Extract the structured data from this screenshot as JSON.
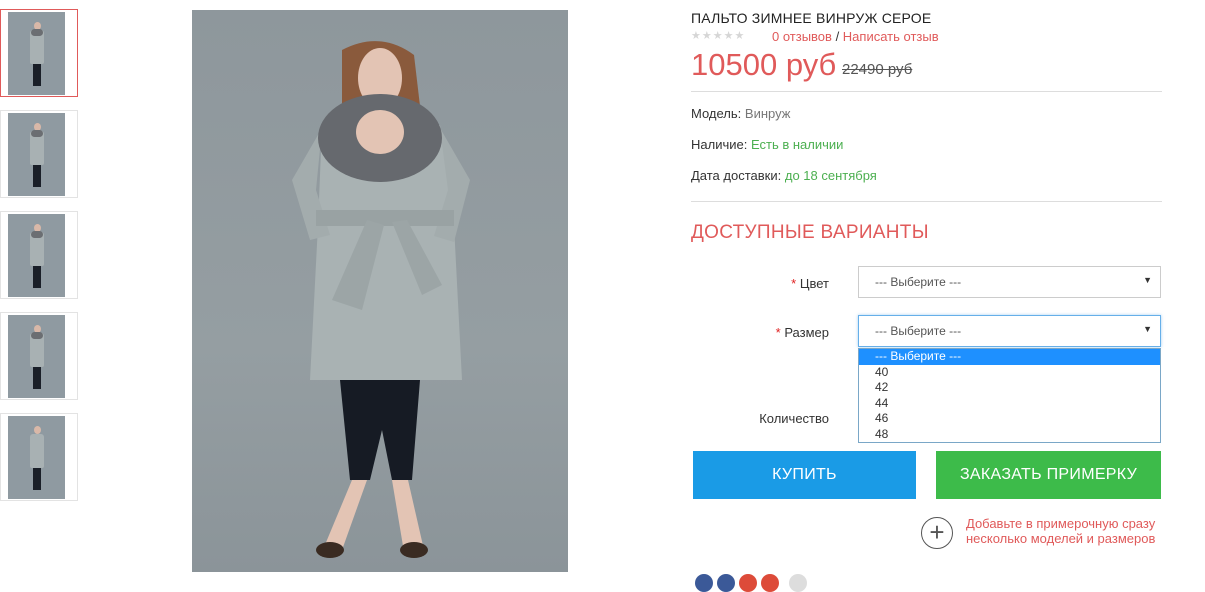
{
  "thumbnails": [
    {
      "label": "thumbnail-1",
      "active": true
    },
    {
      "label": "thumbnail-2",
      "active": false
    },
    {
      "label": "thumbnail-3",
      "active": false
    },
    {
      "label": "thumbnail-4",
      "active": false
    },
    {
      "label": "thumbnail-5",
      "active": false
    }
  ],
  "product": {
    "title": "ПАЛЬТО ЗИМНЕЕ ВИНРУЖ СЕРОЕ",
    "rating_stars": "★★★★★",
    "reviews_link": "0 отзывов",
    "reviews_sep": " / ",
    "write_review_link": "Написать отзыв",
    "price": "10500 руб",
    "old_price": "22490 руб",
    "model_label": "Модель:",
    "model_value": "Винруж",
    "stock_label": "Наличие:",
    "stock_value": "Есть в наличии",
    "delivery_label": "Дата доставки:",
    "delivery_value": "до 18 сентября"
  },
  "options": {
    "title": "ДОСТУПНЫЕ ВАРИАНТЫ",
    "required_mark": "*",
    "color_label": "Цвет",
    "color_value": "--- Выберите ---",
    "size_label": "Размер",
    "size_value": "--- Выберите ---",
    "size_options": [
      "--- Выберите ---",
      "40",
      "42",
      "44",
      "46",
      "48"
    ],
    "quantity_label": "Количество"
  },
  "actions": {
    "buy_label": "КУПИТЬ",
    "try_on_label": "ЗАКАЗАТЬ ПРИМЕРКУ",
    "add_icon": "+",
    "add_note": "Добавьте в примерочную сразу несколько моделей и размеров"
  },
  "colors": {
    "accent": "#e05a5a",
    "buy": "#1a9be6",
    "try_on": "#3dbb4a",
    "in_stock": "#4caf50"
  }
}
